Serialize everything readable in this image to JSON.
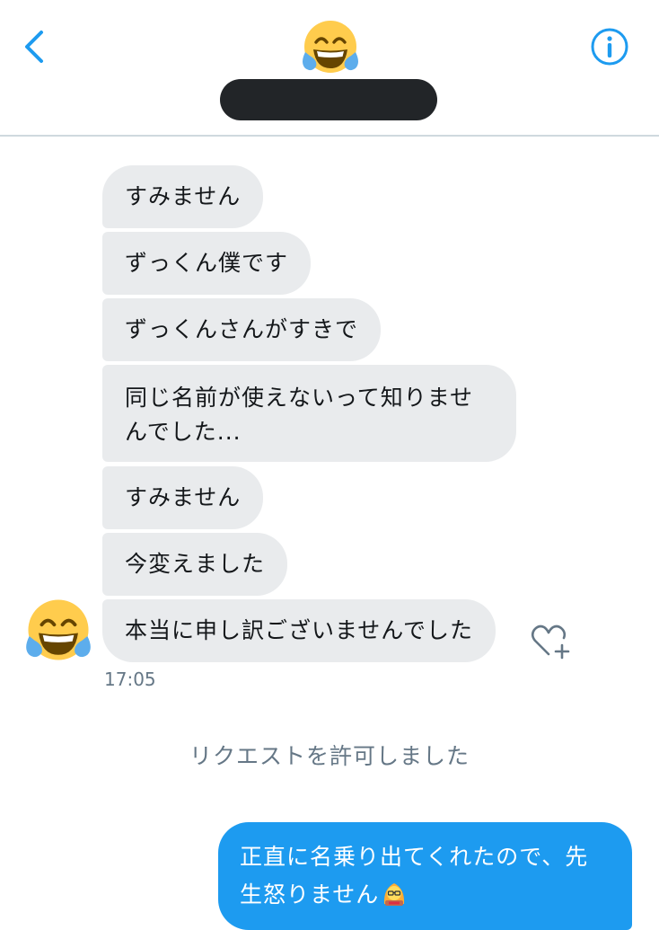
{
  "colors": {
    "accent": "#1d9bf0",
    "incoming_bubble": "#e9ebed",
    "outgoing_bubble": "#1d9bf0",
    "muted_text": "#657786",
    "name_redaction": "#222528"
  },
  "header": {
    "back_icon": "chevron-left-icon",
    "info_icon": "info-circle-icon",
    "avatar_icon": "face-with-tears-of-joy-emoji"
  },
  "messages": {
    "incoming": [
      "すみません",
      "ずっくん僕です",
      "ずっくんさんがすきで",
      "同じ名前が使えないって知りませんでした...",
      "すみません",
      "今変えました",
      "本当に申し訳ございませんでした"
    ],
    "timestamp": "17:05",
    "like_icon": "heart-plus-icon"
  },
  "system_message": "リクエストを許可しました",
  "outgoing": {
    "text": "正直に名乗り出てくれたので、先生怒りません",
    "emoji_icon": "woman-teacher-emoji"
  }
}
